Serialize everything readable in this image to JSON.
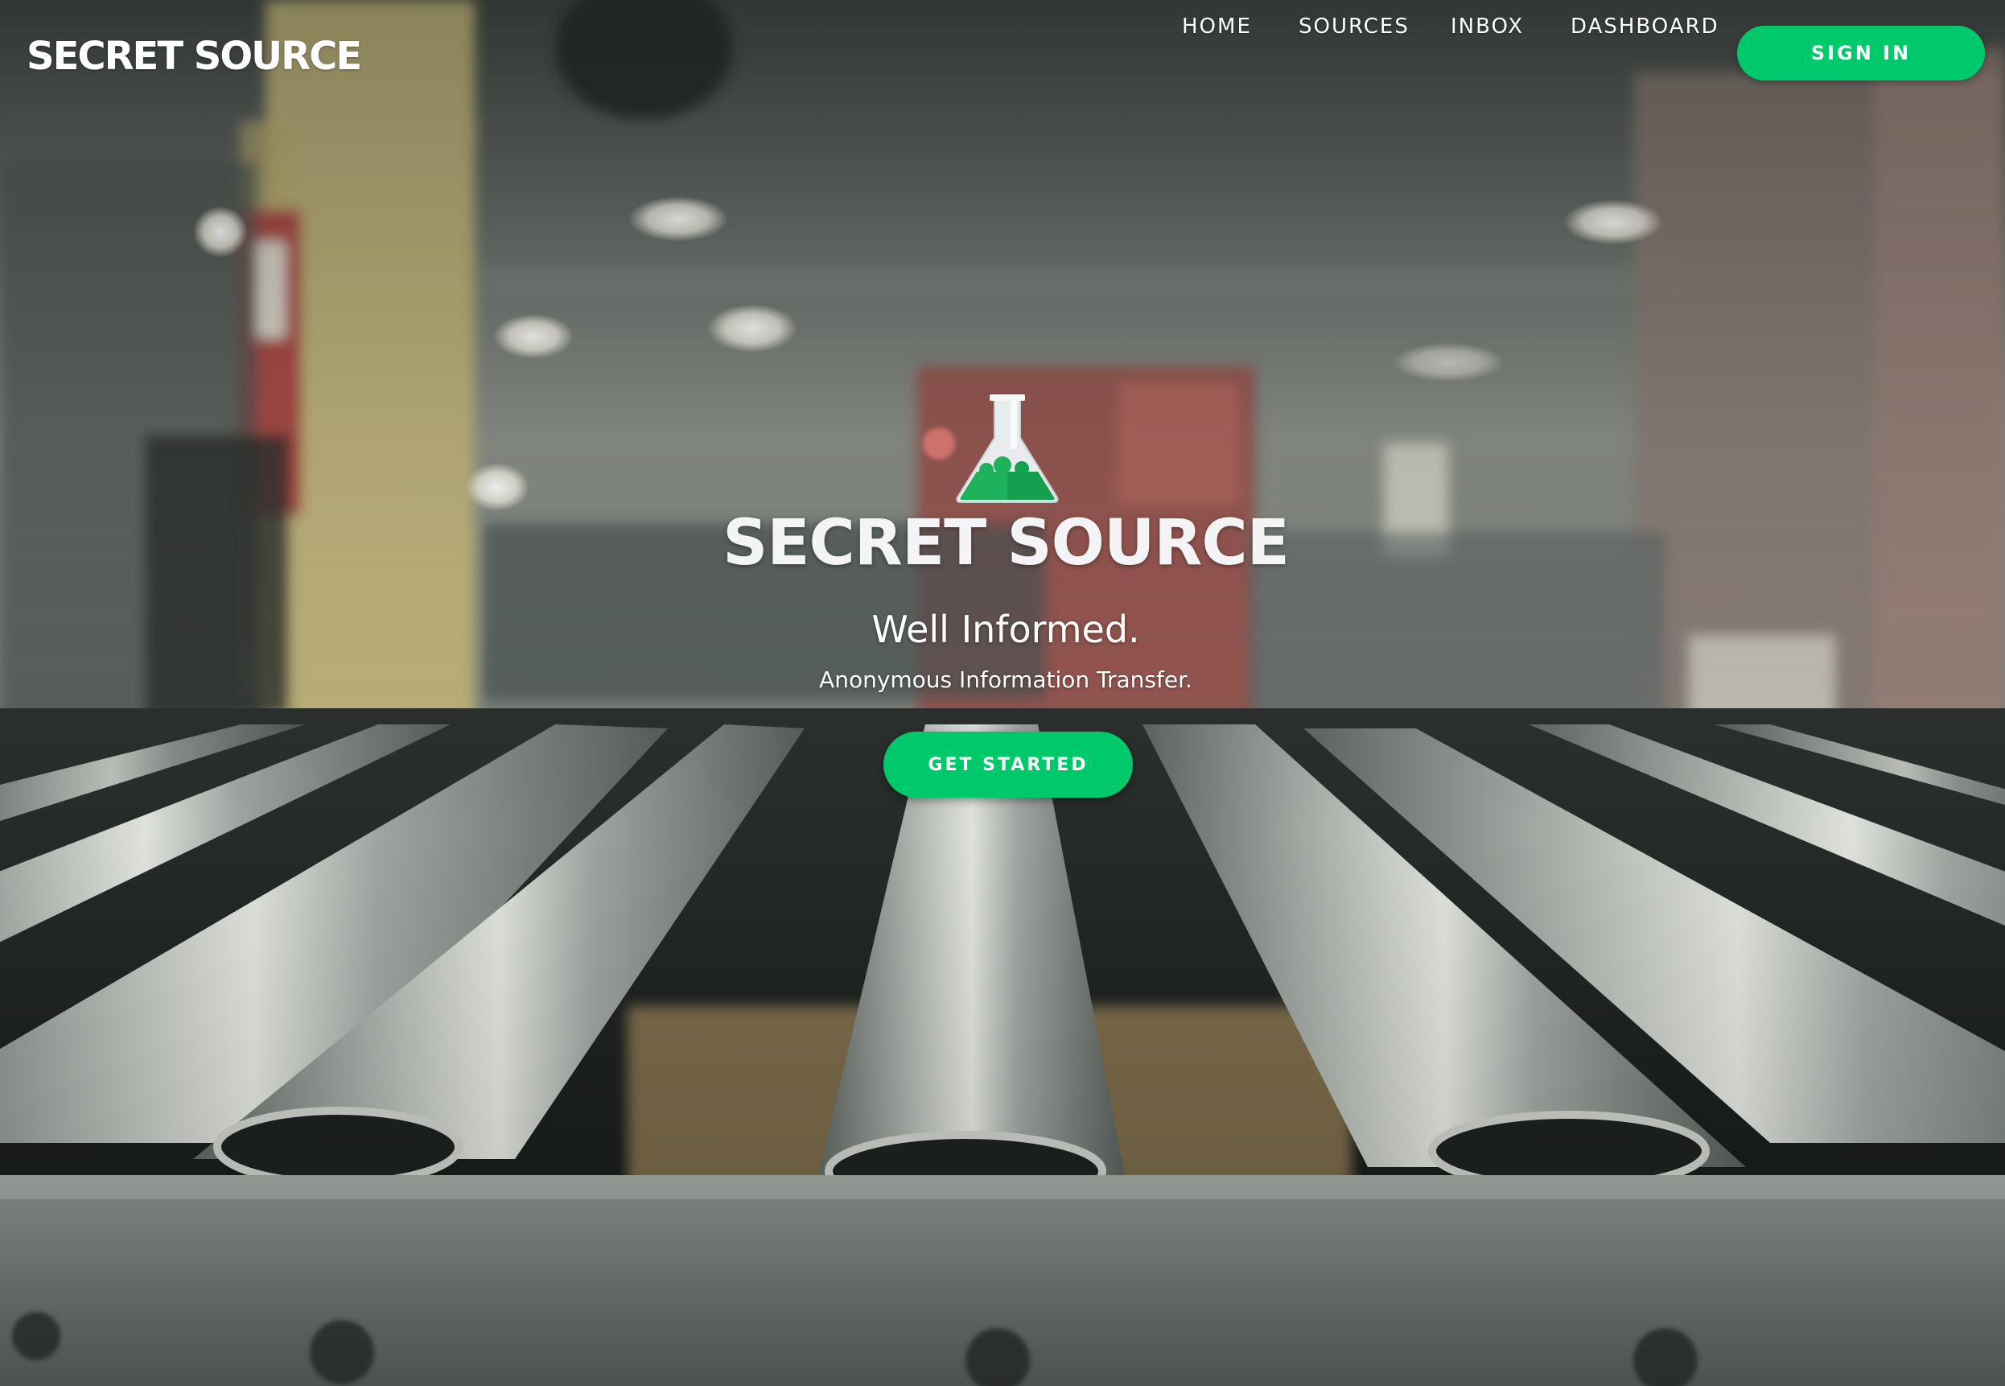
{
  "nav": {
    "brand": "SECRET SOURCE",
    "links": [
      "HOME",
      "SOURCES",
      "INBOX",
      "DASHBOARD"
    ],
    "signin_label": "SIGN IN"
  },
  "hero": {
    "logo_icon": "flask-icon",
    "title": "SECRET SOURCE",
    "tagline": "Well Informed.",
    "subtitle": "Anonymous Information Transfer.",
    "cta_label": "GET STARTED",
    "background": "blurred-warehouse-conveyor-rollers-photo"
  },
  "colors": {
    "accent": "#00c96b",
    "text": "#ffffff"
  }
}
